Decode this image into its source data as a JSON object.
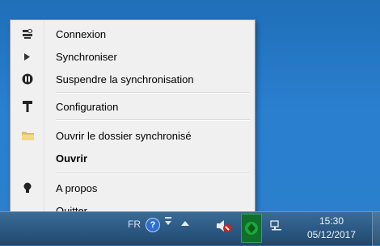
{
  "menu": {
    "items": [
      {
        "label": "Connexion",
        "icon": "connection-icon",
        "bold": false
      },
      {
        "label": "Synchroniser",
        "icon": "play-icon",
        "bold": false
      },
      {
        "label": "Suspendre la synchronisation",
        "icon": "pause-icon",
        "bold": false
      },
      {
        "label": "Configuration",
        "icon": "tools-icon",
        "bold": false
      },
      {
        "label": "Ouvrir le dossier synchronisé",
        "icon": "folder-icon",
        "bold": false
      },
      {
        "label": "Ouvrir",
        "icon": "",
        "bold": true
      },
      {
        "label": "A propos",
        "icon": "lightbulb-icon",
        "bold": false
      },
      {
        "label": "Quitter",
        "icon": "",
        "bold": false
      }
    ]
  },
  "taskbar": {
    "language": "FR",
    "time": "15:30",
    "date": "05/12/2017"
  },
  "colors": {
    "menu_background": "#f0f0f0",
    "taskbar": "#2c5a84",
    "desktop": "#2a7fcf",
    "app_tray_icon": "#0f6f2b"
  }
}
